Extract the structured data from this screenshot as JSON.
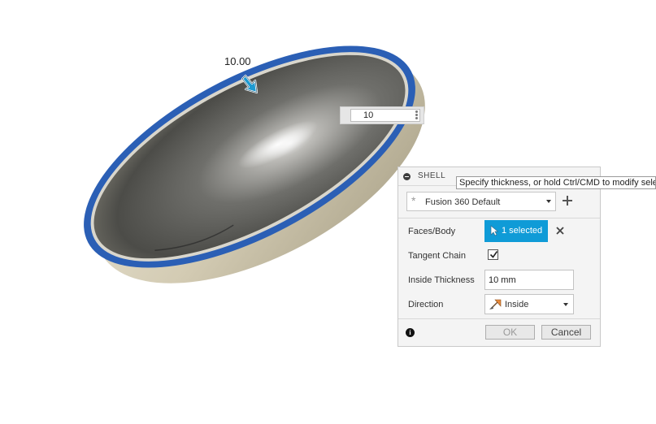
{
  "canvas": {
    "dimension_label": "10.00",
    "hud_input_value": "10",
    "colors": {
      "rim": "#2b5fb5",
      "arrow": "#1e9ad1",
      "shell_outer": "#cfc7b0"
    }
  },
  "tooltip": {
    "text": "Specify thickness, or hold Ctrl/CMD to modify selec"
  },
  "dialog": {
    "title": "SHELL",
    "preset": {
      "value": "Fusion 360 Default"
    },
    "faces_body": {
      "label": "Faces/Body",
      "selection": "1 selected"
    },
    "tangent_chain": {
      "label": "Tangent Chain",
      "checked": true
    },
    "inside_thickness": {
      "label": "Inside Thickness",
      "value": "10 mm"
    },
    "direction": {
      "label": "Direction",
      "value": "Inside"
    },
    "buttons": {
      "ok": "OK",
      "cancel": "Cancel"
    },
    "colors": {
      "selection_button": "#0f9bd7"
    }
  }
}
